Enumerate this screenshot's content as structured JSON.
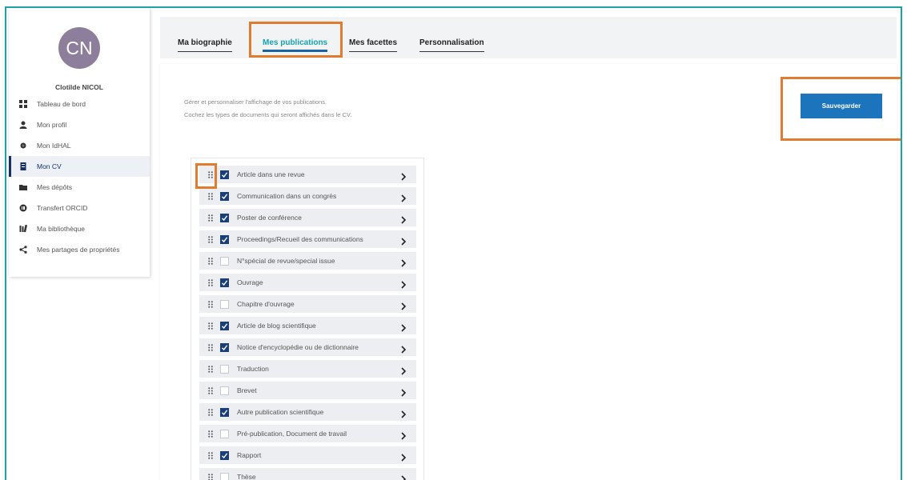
{
  "user": {
    "initials": "CN",
    "name": "Clotilde NICOL"
  },
  "sidebar": {
    "items": [
      {
        "label": "Tableau de bord",
        "icon": "dashboard-icon"
      },
      {
        "label": "Mon profil",
        "icon": "user-icon"
      },
      {
        "label": "Mon IdHAL",
        "icon": "idhal-icon"
      },
      {
        "label": "Mon CV",
        "icon": "cv-icon",
        "active": true
      },
      {
        "label": "Mes dépôts",
        "icon": "folder-icon"
      },
      {
        "label": "Transfert ORCID",
        "icon": "orcid-icon"
      },
      {
        "label": "Ma bibliothèque",
        "icon": "library-icon"
      },
      {
        "label": "Mes partages de propriétés",
        "icon": "share-icon"
      }
    ]
  },
  "tabs": [
    {
      "label": "Ma biographie",
      "active": false
    },
    {
      "label": "Mes publications",
      "active": true
    },
    {
      "label": "Mes facettes",
      "active": false
    },
    {
      "label": "Personnalisation",
      "active": false
    }
  ],
  "content": {
    "intro_line1": "Gérer et personnaliser l'affichage de vos publications.",
    "intro_line2": "Cochez les types de documents qui seront affichés dans le CV.",
    "save_label": "Sauvegarder"
  },
  "document_types": [
    {
      "label": "Article dans une revue",
      "checked": true
    },
    {
      "label": "Communication dans un congrès",
      "checked": true
    },
    {
      "label": "Poster de conférence",
      "checked": true
    },
    {
      "label": "Proceedings/Recueil des communications",
      "checked": true
    },
    {
      "label": "N°spécial de revue/special issue",
      "checked": false
    },
    {
      "label": "Ouvrage",
      "checked": true
    },
    {
      "label": "Chapitre d'ouvrage",
      "checked": false
    },
    {
      "label": "Article de blog scientifique",
      "checked": true
    },
    {
      "label": "Notice d'encyclopédie ou de dictionnaire",
      "checked": true
    },
    {
      "label": "Traduction",
      "checked": false
    },
    {
      "label": "Brevet",
      "checked": false
    },
    {
      "label": "Autre publication scientifique",
      "checked": true
    },
    {
      "label": "Pré-publication, Document de travail",
      "checked": false
    },
    {
      "label": "Rapport",
      "checked": true
    },
    {
      "label": "Thèse",
      "checked": false
    }
  ],
  "colors": {
    "frame": "#1aa4a9",
    "highlight": "#e07c2f",
    "primary": "#1c75bc",
    "active_tab": "#17a2b3",
    "checkbox": "#1a3e7a"
  }
}
